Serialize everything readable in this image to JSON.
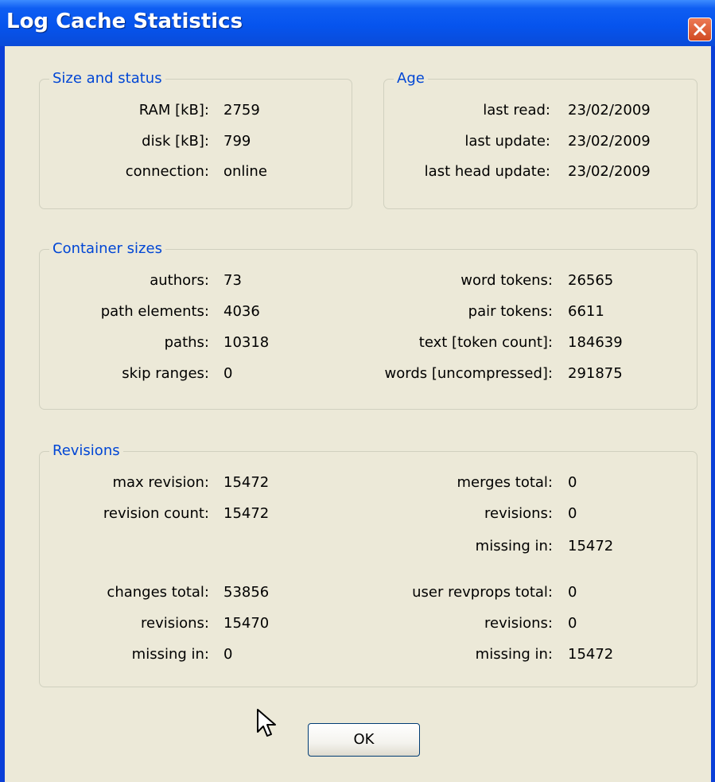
{
  "window": {
    "title": "Log Cache Statistics"
  },
  "size_status": {
    "title": "Size and status",
    "rows": [
      {
        "label": "RAM [kB]:",
        "value": "2759"
      },
      {
        "label": "disk [kB]:",
        "value": "799"
      },
      {
        "label": "connection:",
        "value": "online"
      }
    ]
  },
  "age": {
    "title": "Age",
    "rows": [
      {
        "label": "last read:",
        "value": "23/02/2009"
      },
      {
        "label": "last update:",
        "value": "23/02/2009"
      },
      {
        "label": "last head update:",
        "value": "23/02/2009"
      }
    ]
  },
  "container": {
    "title": "Container sizes",
    "left": [
      {
        "label": "authors:",
        "value": "73"
      },
      {
        "label": "path elements:",
        "value": "4036"
      },
      {
        "label": "paths:",
        "value": "10318"
      },
      {
        "label": "skip ranges:",
        "value": "0"
      }
    ],
    "right": [
      {
        "label": "word tokens:",
        "value": "26565"
      },
      {
        "label": "pair tokens:",
        "value": "6611"
      },
      {
        "label": "text [token count]:",
        "value": "184639"
      },
      {
        "label": "words [uncompressed]:",
        "value": "291875"
      }
    ]
  },
  "revisions": {
    "title": "Revisions",
    "left_top": [
      {
        "label": "max revision:",
        "value": "15472"
      },
      {
        "label": "revision count:",
        "value": "15472"
      }
    ],
    "left_bottom": [
      {
        "label": "changes total:",
        "value": "53856"
      },
      {
        "label": "revisions:",
        "value": "15470"
      },
      {
        "label": "missing in:",
        "value": "0"
      }
    ],
    "right_top": [
      {
        "label": "merges total:",
        "value": "0"
      },
      {
        "label": "revisions:",
        "value": "0"
      },
      {
        "label": "missing in:",
        "value": "15472"
      }
    ],
    "right_bottom": [
      {
        "label": "user revprops total:",
        "value": "0"
      },
      {
        "label": "revisions:",
        "value": "0"
      },
      {
        "label": "missing in:",
        "value": "15472"
      }
    ]
  },
  "buttons": {
    "ok": "OK"
  },
  "icons": {
    "close": "close-icon",
    "cursor": "mouse-pointer-icon"
  }
}
